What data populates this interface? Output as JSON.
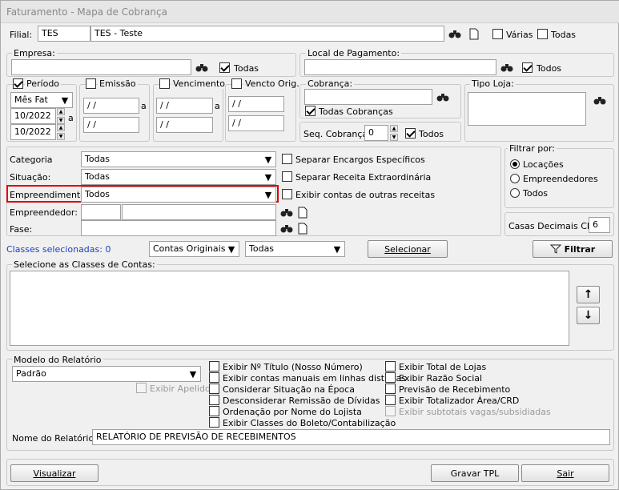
{
  "title": "Faturamento - Mapa de Cobrança",
  "filial": {
    "label": "Filial:",
    "code": "TES",
    "name": "TES - Teste",
    "varias": "Várias",
    "todas": "Todas"
  },
  "empresa": {
    "legend": "Empresa:",
    "todos": "Todas"
  },
  "local": {
    "legend": "Local de Pagamento:",
    "todos": "Todos"
  },
  "periodo": {
    "legend": "Período",
    "tipo": "Mês Fat",
    "de": "10/2022",
    "ate": "10/2022",
    "a": "a"
  },
  "emissao": {
    "legend": "Emissão",
    "de": "/ /",
    "ate": "/ /",
    "a": "a"
  },
  "vencimento": {
    "legend": "Vencimento",
    "de": "/ /",
    "ate": "/ /",
    "a": "a"
  },
  "vencto_orig": {
    "legend": "Vencto Orig.",
    "de": "/ /",
    "ate": "/ /"
  },
  "cobranca": {
    "legend": "Cobrança:",
    "todas": "Todas Cobranças",
    "seq_label": "Seq. Cobrança:",
    "seq": "0",
    "todos": "Todos"
  },
  "tipo_loja": {
    "legend": "Tipo Loja:"
  },
  "filters": {
    "categoria_label": "Categoria",
    "categoria": "Todas",
    "situacao_label": "Situação:",
    "situacao": "Todas",
    "empreend_label": "Empreendimento:",
    "empreend": "Todos",
    "empreendedor_label": "Empreendedor:",
    "fase_label": "Fase:",
    "separar_encargos": "Separar Encargos Específicos",
    "separar_receita": "Separar Receita Extraordinária",
    "exibir_contas": "Exibir contas de outras receitas"
  },
  "filtrar_por": {
    "legend": "Filtrar por:",
    "opt1": "Locações",
    "opt2": "Empreendedores",
    "opt3": "Todos"
  },
  "casas": {
    "label": "Casas Decimais CRD",
    "value": "6"
  },
  "classes": {
    "selected": "Classes selecionadas: 0",
    "combo1": "Contas Originais",
    "combo2": "Todas",
    "selecionar": "Selecionar",
    "filtrar": "Filtrar",
    "legend": "Selecione as Classes de Contas:"
  },
  "modelo": {
    "legend": "Modelo do Relatório",
    "value": "Padrão",
    "exibir_apelido": "Exibir Apelido"
  },
  "options_col1": [
    "Exibir Nº Título (Nosso Número)",
    "Exibir contas manuais em linhas distintas",
    "Considerar Situação na Época",
    "Desconsiderar Remissão de Dívidas",
    "Ordenação por Nome do Lojista",
    "Exibir Classes do Boleto/Contabilização"
  ],
  "options_col2": [
    "Exibir Total de Lojas",
    "Exibir Razão Social",
    "Previsão de Recebimento",
    "Exibir Totalizador Área/CRD",
    "Exibir subtotais vagas/subsidiadas"
  ],
  "nome_relatorio": {
    "label": "Nome do Relatório:",
    "value": "RELATÓRIO DE PREVISÃO DE RECEBIMENTOS"
  },
  "footer": {
    "visualizar": "Visualizar",
    "gravar": "Gravar TPL",
    "sair": "Sair"
  }
}
